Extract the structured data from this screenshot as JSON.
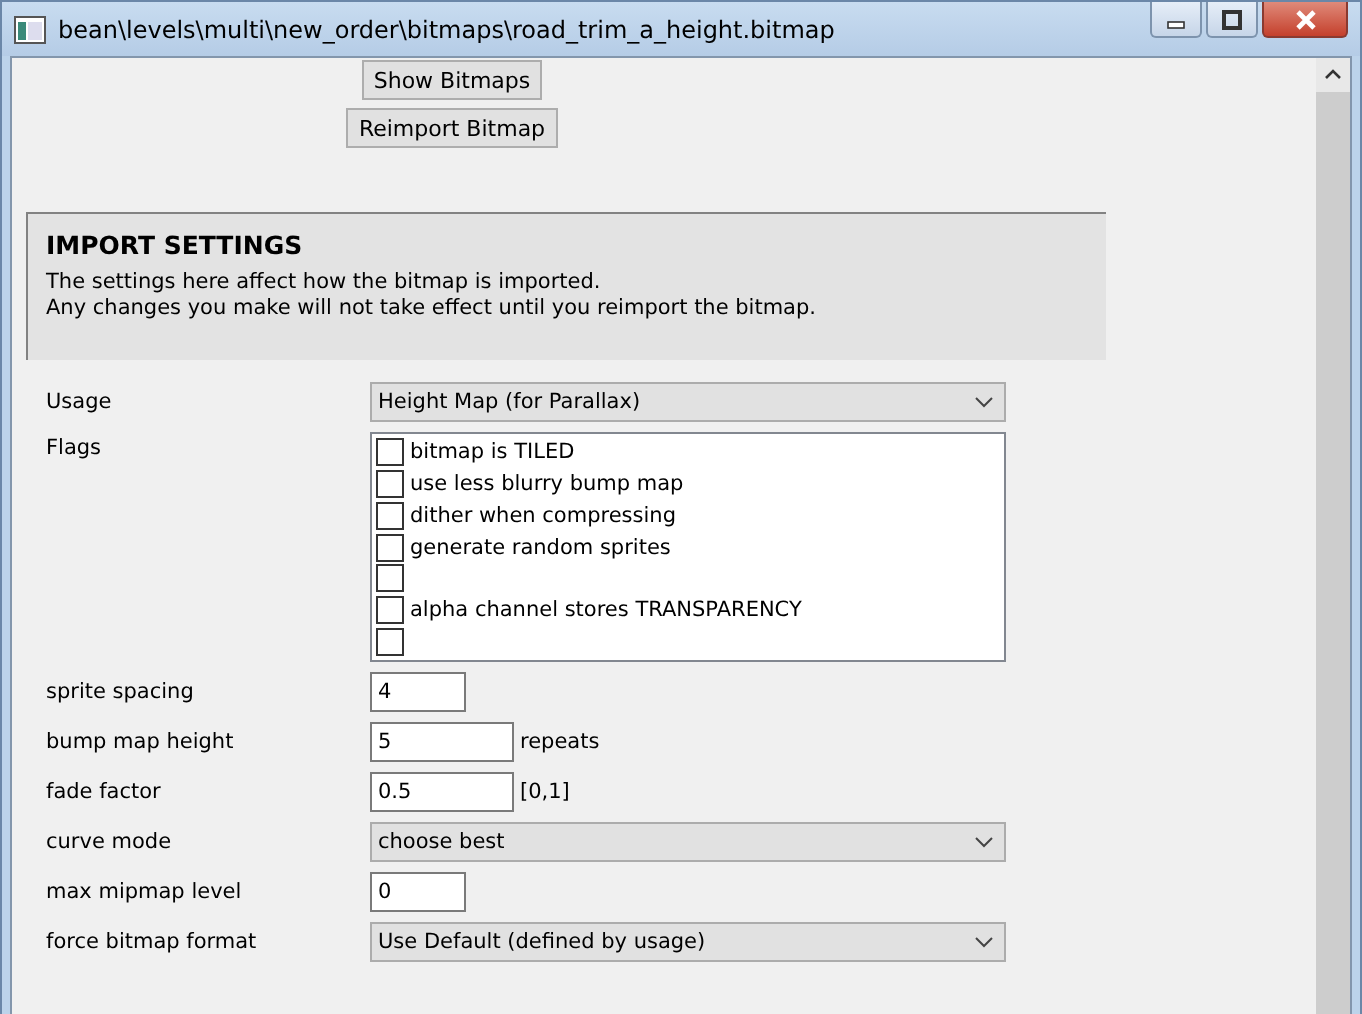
{
  "window": {
    "title": "bean\\levels\\multi\\new_order\\bitmaps\\road_trim_a_height.bitmap"
  },
  "buttons": [
    "Show Bitmaps",
    "Reimport Bitmap"
  ],
  "import_settings": {
    "heading": "IMPORT SETTINGS",
    "description": [
      "The settings here affect how the bitmap is imported.",
      "Any changes you make will not take effect until you reimport the bitmap."
    ]
  },
  "settings": [
    {
      "kind": "dropdown",
      "label": "Usage",
      "value": "Height Map (for Parallax)"
    },
    {
      "kind": "flags",
      "label": "Flags",
      "items": [
        {
          "label": "bitmap is TILED",
          "checked": false
        },
        {
          "label": "use less blurry bump map",
          "checked": false
        },
        {
          "label": "dither when compressing",
          "checked": false
        },
        {
          "label": "generate random sprites",
          "checked": false
        },
        {
          "checked": false
        },
        {
          "label": "alpha channel stores TRANSPARENCY",
          "checked": false
        },
        {
          "checked": false
        }
      ]
    },
    {
      "kind": "short-field",
      "label": "sprite spacing",
      "value": "4"
    },
    {
      "kind": "field",
      "label": "bump map height",
      "value": "5",
      "suffix": "repeats"
    },
    {
      "kind": "field",
      "label": "fade factor",
      "value": "0.5",
      "suffix": "[0,1]"
    },
    {
      "kind": "dropdown",
      "label": "curve mode",
      "value": "choose best"
    },
    {
      "kind": "short-field",
      "label": "max mipmap level",
      "value": "0"
    },
    {
      "kind": "dropdown",
      "label": "force bitmap format",
      "value": "Use Default (defined by usage)"
    }
  ]
}
